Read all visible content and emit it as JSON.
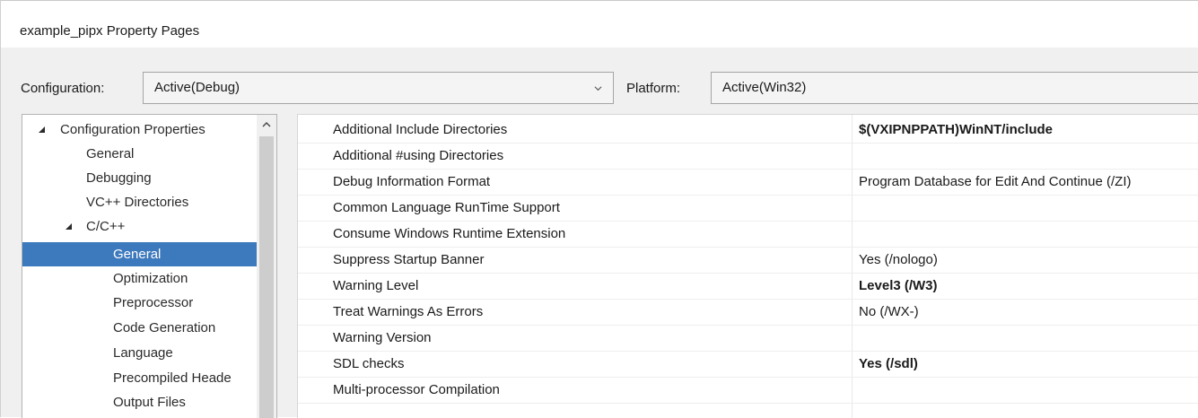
{
  "window": {
    "title": "example_pipx Property Pages"
  },
  "config_bar": {
    "configuration_label": "Configuration:",
    "configuration_value": "Active(Debug)",
    "platform_label": "Platform:",
    "platform_value": "Active(Win32)"
  },
  "tree": {
    "items": [
      {
        "label": "Configuration Properties",
        "expanded": true
      },
      {
        "label": "General"
      },
      {
        "label": "Debugging"
      },
      {
        "label": "VC++ Directories"
      },
      {
        "label": "C/C++",
        "expanded": true
      },
      {
        "label": "General",
        "selected": true
      },
      {
        "label": "Optimization"
      },
      {
        "label": "Preprocessor"
      },
      {
        "label": "Code Generation"
      },
      {
        "label": "Language"
      },
      {
        "label": "Precompiled Heade"
      },
      {
        "label": "Output Files"
      }
    ]
  },
  "properties": [
    {
      "name": "Additional Include Directories",
      "value": "$(VXIPNPPATH)WinNT/include",
      "bold": true
    },
    {
      "name": "Additional #using Directories",
      "value": ""
    },
    {
      "name": "Debug Information Format",
      "value": "Program Database for Edit And Continue (/ZI)"
    },
    {
      "name": "Common Language RunTime Support",
      "value": ""
    },
    {
      "name": "Consume Windows Runtime Extension",
      "value": ""
    },
    {
      "name": "Suppress Startup Banner",
      "value": "Yes (/nologo)"
    },
    {
      "name": "Warning Level",
      "value": "Level3 (/W3)",
      "bold": true
    },
    {
      "name": "Treat Warnings As Errors",
      "value": "No (/WX-)"
    },
    {
      "name": "Warning Version",
      "value": ""
    },
    {
      "name": "SDL checks",
      "value": "Yes (/sdl)",
      "bold": true
    },
    {
      "name": "Multi-processor Compilation",
      "value": ""
    }
  ],
  "colors": {
    "selection": "#3d79bd",
    "window_bg": "#f0f0f0"
  },
  "icons": {
    "dropdown": "chevron-down-icon",
    "expander": "expanded-triangle-icon",
    "scroll_up": "chevron-up-icon"
  }
}
